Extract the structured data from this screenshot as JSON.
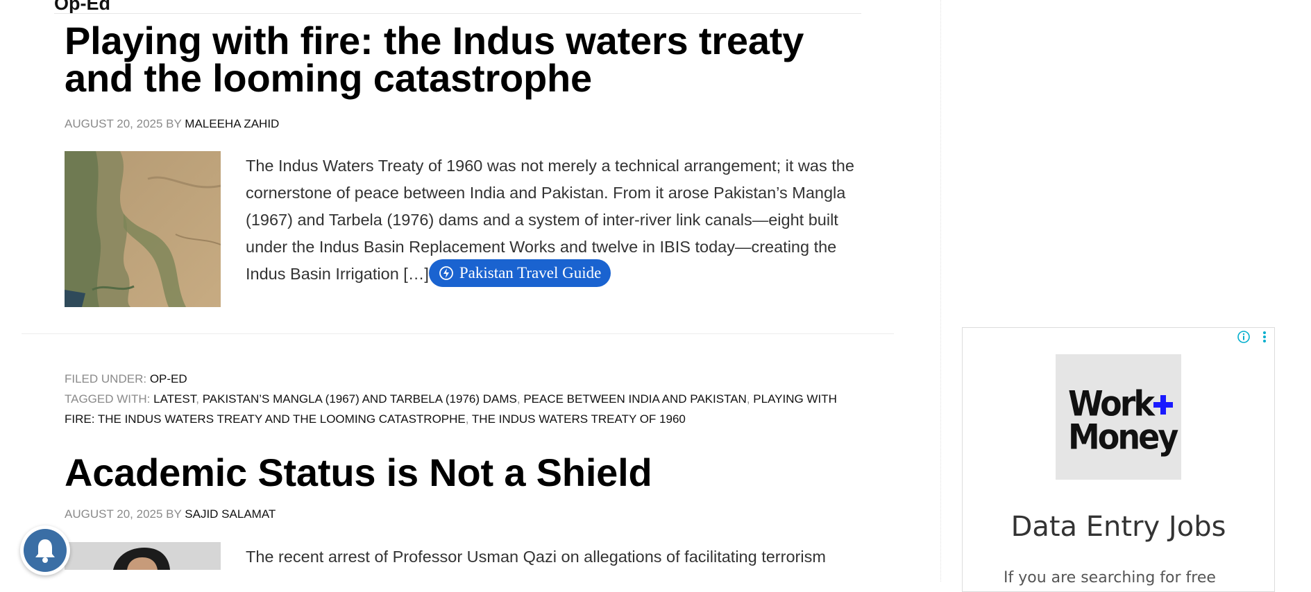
{
  "section": {
    "label": "Op-Ed"
  },
  "article1": {
    "title": "Playing with fire: the Indus waters treaty and the looming catastrophe",
    "date": "AUGUST 20, 2025",
    "by": "BY",
    "author": "MALEEHA ZAHID",
    "excerpt": "The Indus Waters Treaty of 1960 was not merely a technical arrangement; it was the cornerstone of peace between India and Pakistan. From it arose Pakistan’s Mangla (1967) and Tarbela (1976) dams and a system of inter-river link canals—eight built under the Indus Basin Replacement Works and twelve in IBIS today—creating the Indus Basin Irrigation […]",
    "travel_button": "Pakistan Travel Guide",
    "filed_under_label": "FILED UNDER:",
    "filed_under": "OP-ED",
    "tagged_with_label": "TAGGED WITH:",
    "tags": [
      "LATEST",
      "PAKISTAN’S MANGLA (1967) AND TARBELA (1976) DAMS",
      "PEACE BETWEEN INDIA AND PAKISTAN",
      "PLAYING WITH FIRE: THE INDUS WATERS TREATY AND THE LOOMING CATASTROPHE",
      "THE INDUS WATERS TREATY OF 1960"
    ]
  },
  "article2": {
    "title": "Academic Status is Not a Shield",
    "date": "AUGUST 20, 2025",
    "by": "BY",
    "author": "SAJID SALAMAT",
    "excerpt": "The recent arrest of Professor Usman Qazi on allegations of facilitating terrorism"
  },
  "ad": {
    "logo_line1": "Work",
    "logo_line2": "Money",
    "title": "Data Entry Jobs",
    "description": "If you are searching for free",
    "accent_color": "#1a1aff",
    "info_color": "#00aecd"
  },
  "icons": {
    "bell": "bell-icon",
    "bolt": "bolt-icon",
    "info": "info-icon",
    "menu": "kebab-menu-icon"
  }
}
